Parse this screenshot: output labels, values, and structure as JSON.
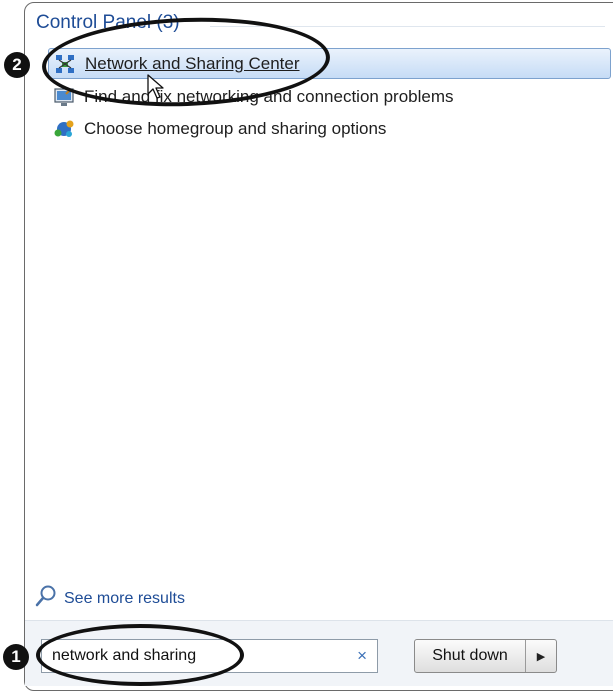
{
  "group": {
    "title": "Control Panel (3)"
  },
  "results": [
    {
      "label": "Network and Sharing Center",
      "icon": "network-center-icon",
      "selected": true
    },
    {
      "label": "Find and fix networking and connection problems",
      "icon": "troubleshoot-icon",
      "selected": false
    },
    {
      "label": "Choose homegroup and sharing options",
      "icon": "homegroup-icon",
      "selected": false
    }
  ],
  "see_more": {
    "label": "See more results",
    "icon": "magnifier-icon"
  },
  "search": {
    "value": "network and sharing",
    "clear_glyph": "×"
  },
  "shutdown": {
    "label": "Shut down",
    "arrow_glyph": "▶"
  },
  "callouts": [
    {
      "number": "1",
      "target": "search box"
    },
    {
      "number": "2",
      "target": "Network and Sharing Center"
    }
  ],
  "colors": {
    "header_text": "#1e4c96",
    "selection_border": "#7da2ce",
    "selection_fill_top": "#eaf2fc",
    "selection_fill_bottom": "#c6dcf6",
    "callout": "#111111"
  }
}
